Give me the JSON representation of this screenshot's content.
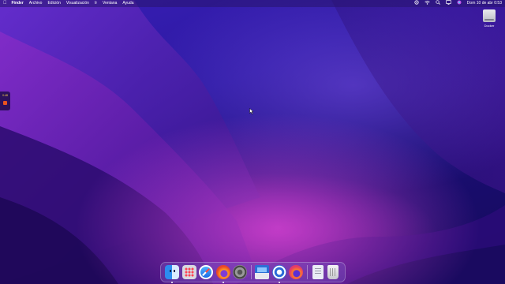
{
  "menubar": {
    "apple_icon": "apple-icon",
    "items": [
      "Finder",
      "Archivo",
      "Edición",
      "Visualización",
      "Ir",
      "Ventana",
      "Ayuda"
    ],
    "status_icons": [
      "control-center-icon",
      "wifi-icon",
      "search-icon",
      "display-icon",
      "siri-icon"
    ],
    "clock": "Dom 10 de abr  0:53"
  },
  "desktop": {
    "drive_label": "Docker"
  },
  "widget": {
    "time": "0:48"
  },
  "dock": {
    "apps": [
      "finder",
      "launchpad",
      "safari",
      "firefox",
      "system-preferences",
      "preview",
      "disk-utility",
      "firefox-developer-edition",
      "documents",
      "trash"
    ]
  },
  "colors": {
    "wallpaper_top": "#3b1fb8",
    "wallpaper_bottom": "#14095a",
    "accent_magenta": "#c828c8"
  }
}
